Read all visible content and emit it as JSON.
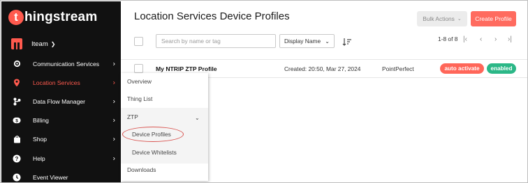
{
  "brand": {
    "logo_letter": "t",
    "logo_text": "hingstream",
    "accent": "#ff5a4e"
  },
  "team": {
    "label": "Iteam"
  },
  "sidebar": {
    "items": [
      {
        "label": "Communication Services",
        "icon": "gear-icon",
        "has_arrow": true
      },
      {
        "label": "Location Services",
        "icon": "location-pin-icon",
        "has_arrow": true,
        "active": true
      },
      {
        "label": "Data Flow Manager",
        "icon": "flow-icon",
        "has_arrow": true
      },
      {
        "label": "Billing",
        "icon": "billing-icon",
        "has_arrow": true
      },
      {
        "label": "Shop",
        "icon": "shop-bag-icon",
        "has_arrow": true
      },
      {
        "label": "Help",
        "icon": "help-icon",
        "has_arrow": true
      },
      {
        "label": "Event Viewer",
        "icon": "event-viewer-icon",
        "has_arrow": false
      }
    ]
  },
  "header": {
    "title": "Location Services Device Profiles",
    "bulk_actions_label": "Bulk Actions",
    "create_label": "Create Profile"
  },
  "toolbar": {
    "search_placeholder": "Search by name or tag",
    "sort_value": "Display Name",
    "pagination_text": "1-8 of 8"
  },
  "table": {
    "rows": [
      {
        "name": "My NTRIP ZTP Profile",
        "created": "Created: 20:50, Mar 27, 2024",
        "service": "PointPerfect",
        "badges": [
          {
            "label": "auto activate",
            "color": "#ff6659"
          },
          {
            "label": "enabled",
            "color": "#2bb787"
          }
        ]
      }
    ]
  },
  "flyout": {
    "overview": "Overview",
    "thing_list": "Thing List",
    "ztp": "ZTP",
    "device_profiles": "Device Profiles",
    "device_whitelists": "Device Whitelists",
    "downloads": "Downloads"
  }
}
